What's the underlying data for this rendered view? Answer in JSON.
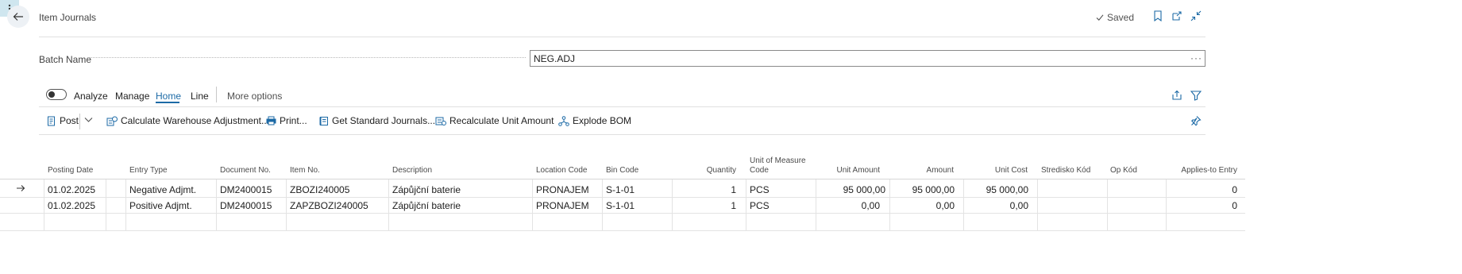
{
  "header": {
    "title": "Item Journals",
    "saved_label": "Saved"
  },
  "batch": {
    "label": "Batch Name",
    "value": "NEG.ADJ",
    "more": "···"
  },
  "tabs": {
    "analyze": "Analyze",
    "manage": "Manage",
    "home": "Home",
    "line": "Line",
    "more_options": "More options"
  },
  "actions": {
    "post": "Post",
    "calc_whse": "Calculate Warehouse Adjustment...",
    "print": "Print...",
    "get_std": "Get Standard Journals...",
    "recalc": "Recalculate Unit Amount",
    "explode": "Explode BOM"
  },
  "columns": {
    "posting_date": "Posting Date",
    "entry_type": "Entry Type",
    "document_no": "Document No.",
    "item_no": "Item No.",
    "description": "Description",
    "location_code": "Location Code",
    "bin_code": "Bin Code",
    "quantity": "Quantity",
    "uom_line1": "Unit of Measure",
    "uom_line2": "Code",
    "unit_amount": "Unit Amount",
    "amount": "Amount",
    "unit_cost": "Unit Cost",
    "stredisko": "Stredisko Kód",
    "op_kod": "Op Kód",
    "applies_to": "Applies-to Entry"
  },
  "rows": [
    {
      "posting_date": "01.02.2025",
      "entry_type": "Negative Adjmt.",
      "document_no": "DM2400015",
      "item_no": "ZBOZI240005",
      "description": "Zápůjční baterie",
      "location_code": "PRONAJEM",
      "bin_code": "S-1-01",
      "quantity": "1",
      "uom": "PCS",
      "unit_amount": "95 000,00",
      "amount": "95 000,00",
      "unit_cost": "95 000,00",
      "stredisko": "",
      "op_kod": "",
      "applies_to": "0"
    },
    {
      "posting_date": "01.02.2025",
      "entry_type": "Positive Adjmt.",
      "document_no": "DM2400015",
      "item_no": "ZAPZBOZI240005",
      "description": "Zápůjční baterie",
      "location_code": "PRONAJEM",
      "bin_code": "S-1-01",
      "quantity": "1",
      "uom": "PCS",
      "unit_amount": "0,00",
      "amount": "0,00",
      "unit_cost": "0,00",
      "stredisko": "",
      "op_kod": "",
      "applies_to": "0"
    }
  ],
  "colors": {
    "accent": "#1c6aa6",
    "selected_cell": "#cfe6ef",
    "back_button_bg": "#edf1f5"
  }
}
